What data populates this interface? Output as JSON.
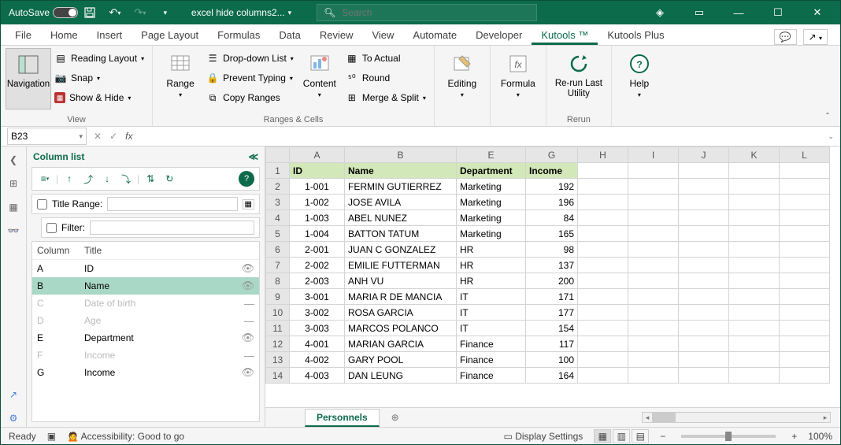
{
  "title_bar": {
    "autosave_label": "AutoSave",
    "autosave_state": "Off",
    "file_name": "excel hide columns2...",
    "search_placeholder": "Search"
  },
  "tabs": {
    "items": [
      "File",
      "Home",
      "Insert",
      "Page Layout",
      "Formulas",
      "Data",
      "Review",
      "View",
      "Automate",
      "Developer",
      "Kutools ™",
      "Kutools Plus"
    ],
    "active": 10
  },
  "ribbon": {
    "view": {
      "big": "Navigation",
      "items": [
        "Reading Layout",
        "Snap",
        "Show & Hide"
      ],
      "label": "View"
    },
    "ranges": {
      "big": "Range",
      "items": [
        "Drop-down List",
        "Prevent Typing",
        "Copy Ranges"
      ],
      "big2": "Content",
      "items2": [
        "To Actual",
        "Round",
        "Merge & Split"
      ],
      "label": "Ranges & Cells"
    },
    "editing": {
      "big": "Editing"
    },
    "formula": {
      "big": "Formula"
    },
    "rerun": {
      "big": "Re-run Last\nUtility",
      "label": "Rerun"
    },
    "help": {
      "big": "Help"
    }
  },
  "formula_bar": {
    "name_box": "B23"
  },
  "col_pane": {
    "title": "Column list",
    "title_range_label": "Title Range:",
    "filter_label": "Filter:",
    "headers": {
      "col": "Column",
      "title": "Title"
    },
    "rows": [
      {
        "c": "A",
        "t": "ID",
        "state": "visible"
      },
      {
        "c": "B",
        "t": "Name",
        "state": "visible",
        "sel": true
      },
      {
        "c": "C",
        "t": "Date of birth",
        "state": "hidden"
      },
      {
        "c": "D",
        "t": "Age",
        "state": "hidden"
      },
      {
        "c": "E",
        "t": "Department",
        "state": "visible"
      },
      {
        "c": "F",
        "t": "Income",
        "state": "hidden"
      },
      {
        "c": "G",
        "t": "Income",
        "state": "visible"
      }
    ]
  },
  "grid": {
    "col_letters": [
      "A",
      "B",
      "E",
      "G",
      "H",
      "I",
      "J",
      "K",
      "L"
    ],
    "headers": [
      "ID",
      "Name",
      "Department",
      "Income"
    ],
    "rows": [
      {
        "n": 2,
        "id": "1-001",
        "name": "FERMIN GUTIERREZ",
        "dept": "Marketing",
        "inc": 192
      },
      {
        "n": 3,
        "id": "1-002",
        "name": "JOSE AVILA",
        "dept": "Marketing",
        "inc": 196
      },
      {
        "n": 4,
        "id": "1-003",
        "name": "ABEL NUNEZ",
        "dept": "Marketing",
        "inc": 84
      },
      {
        "n": 5,
        "id": "1-004",
        "name": "BATTON TATUM",
        "dept": "Marketing",
        "inc": 165
      },
      {
        "n": 6,
        "id": "2-001",
        "name": "JUAN C GONZALEZ",
        "dept": "HR",
        "inc": 98
      },
      {
        "n": 7,
        "id": "2-002",
        "name": "EMILIE FUTTERMAN",
        "dept": "HR",
        "inc": 137
      },
      {
        "n": 8,
        "id": "2-003",
        "name": "ANH VU",
        "dept": "HR",
        "inc": 200
      },
      {
        "n": 9,
        "id": "3-001",
        "name": "MARIA R DE MANCIA",
        "dept": "IT",
        "inc": 171
      },
      {
        "n": 10,
        "id": "3-002",
        "name": "ROSA GARCIA",
        "dept": "IT",
        "inc": 177
      },
      {
        "n": 11,
        "id": "3-003",
        "name": "MARCOS POLANCO",
        "dept": "IT",
        "inc": 154
      },
      {
        "n": 12,
        "id": "4-001",
        "name": "MARIAN GARCIA",
        "dept": "Finance",
        "inc": 117
      },
      {
        "n": 13,
        "id": "4-002",
        "name": "GARY POOL",
        "dept": "Finance",
        "inc": 100
      },
      {
        "n": 14,
        "id": "4-003",
        "name": "DAN LEUNG",
        "dept": "Finance",
        "inc": 164
      }
    ],
    "active_sheet": "Personnels"
  },
  "status": {
    "ready": "Ready",
    "accessibility": "Accessibility: Good to go",
    "display": "Display Settings",
    "zoom": "100%"
  },
  "col_widths": {
    "A": 70,
    "B": 142,
    "E": 88,
    "G": 66,
    "rest": 64
  }
}
